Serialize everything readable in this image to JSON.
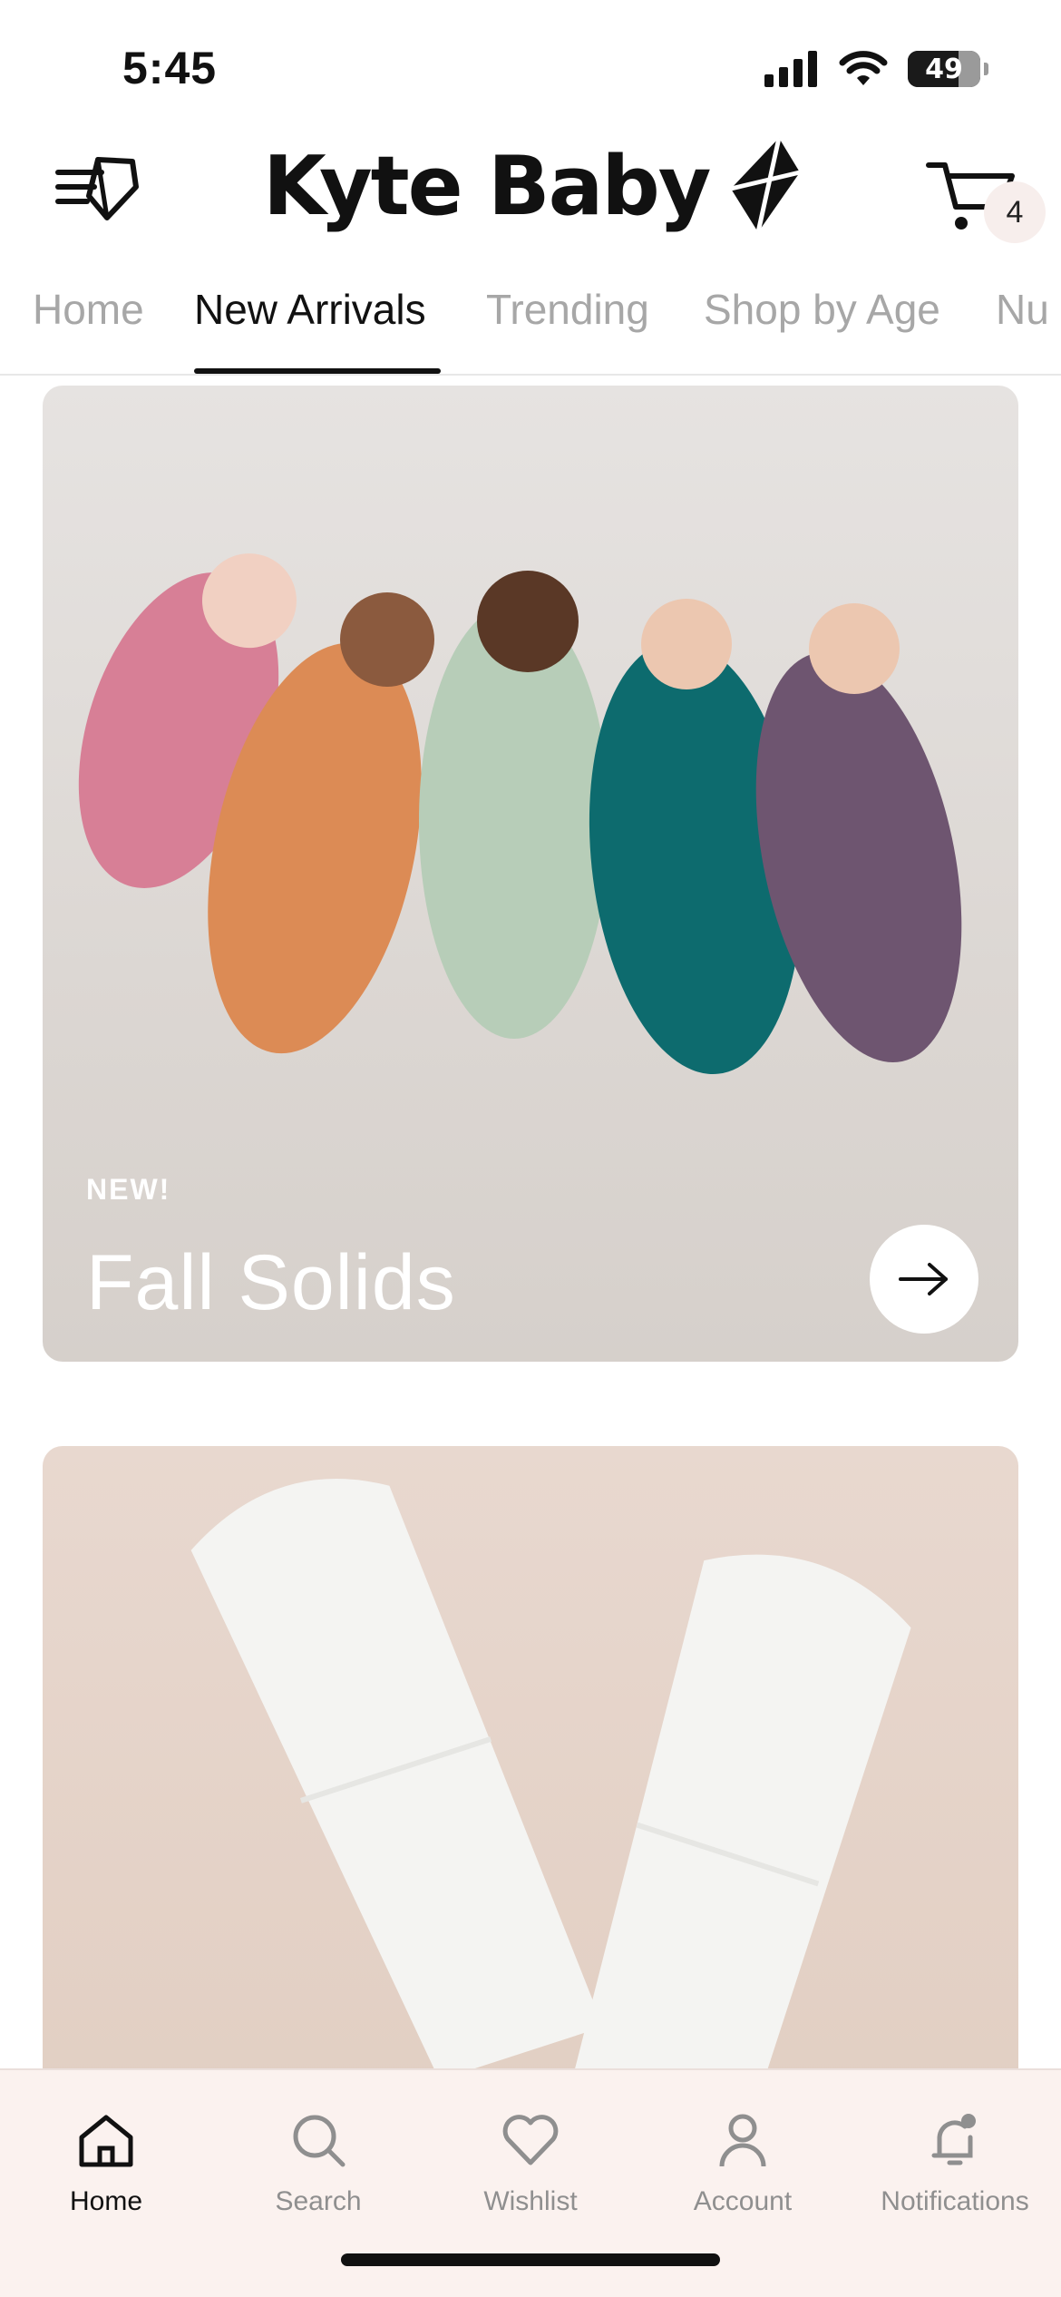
{
  "status_bar": {
    "time": "5:45",
    "battery": "49"
  },
  "header": {
    "brand": "Kyte Baby",
    "cart_count": "4"
  },
  "tabs": [
    {
      "label": "Home",
      "active": false
    },
    {
      "label": "New Arrivals",
      "active": true
    },
    {
      "label": "Trending",
      "active": false
    },
    {
      "label": "Shop by Age",
      "active": false
    },
    {
      "label": "Nu",
      "active": false
    }
  ],
  "cards": [
    {
      "eyebrow": "NEW!",
      "title": "Fall Solids",
      "image": "babies-in-sleep-bags"
    },
    {
      "image": "white-socks"
    }
  ],
  "bottom_nav": [
    {
      "label": "Home",
      "icon": "home-icon",
      "active": true
    },
    {
      "label": "Search",
      "icon": "search-icon",
      "active": false
    },
    {
      "label": "Wishlist",
      "icon": "heart-icon",
      "active": false
    },
    {
      "label": "Account",
      "icon": "account-icon",
      "active": false
    },
    {
      "label": "Notifications",
      "icon": "bell-icon",
      "active": false
    }
  ],
  "colors": {
    "text": "#111111",
    "tab_inactive": "#a7a7a7",
    "nav_background": "#fbf2ef",
    "badge_background": "#f7eeec"
  }
}
